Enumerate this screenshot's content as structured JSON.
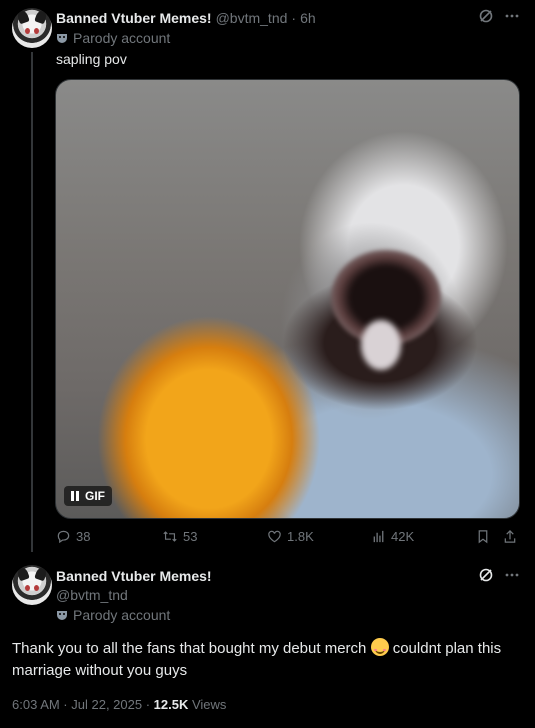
{
  "tweet1": {
    "display_name": "Banned Vtuber Memes!",
    "handle": "@bvtm_tnd",
    "dot": "·",
    "time": "6h",
    "parody_label": "Parody account",
    "text": "sapling pov",
    "media_badge": "GIF",
    "actions": {
      "replies": "38",
      "reposts": "53",
      "likes": "1.8K",
      "views": "42K"
    },
    "more_icon": "more-dots-icon"
  },
  "tweet2": {
    "display_name": "Banned Vtuber Memes!",
    "handle": "@bvtm_tnd",
    "parody_label": "Parody account",
    "text_before_emoji": "Thank you to all the fans that bought my debut merch ",
    "text_after_emoji": " couldnt plan this marriage without you guys",
    "timestamp": "6:03 AM · Jul 22, 2025 · ",
    "views_count": "12.5K",
    "views_label": " Views"
  },
  "colors": {
    "background": "#000000",
    "text": "#e7e9ea",
    "muted": "#71767b"
  }
}
